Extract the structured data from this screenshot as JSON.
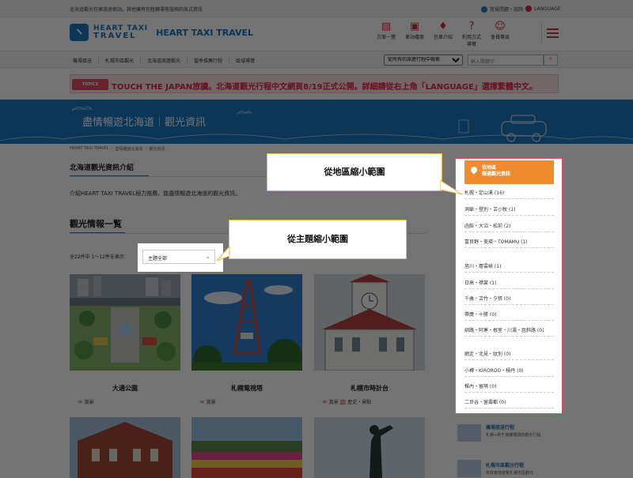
{
  "top_bar": {
    "left_text": "北海道觀光包車旅遊網站。其他擁有包租轉運等服務的各式資訊",
    "lang_links": [
      "常見問題・諮詢",
      "LANGUAGE"
    ]
  },
  "header": {
    "logo_line1": "HEART TAXI",
    "logo_line2": "TRAVEL",
    "brand": "HEART TAXI TRAVEL",
    "icons": [
      {
        "name": "plan-list-icon",
        "label": "方案一覽"
      },
      {
        "name": "area-icon",
        "label": "車站檔案"
      },
      {
        "name": "tour-icon",
        "label": "包車介紹"
      },
      {
        "name": "guide-icon",
        "label": "利用方式導覽"
      },
      {
        "name": "member-icon",
        "label": "會員專頁"
      }
    ]
  },
  "nav": {
    "items": [
      "機場接送",
      "札幌市區觀光",
      "北海道周遊觀光",
      "當季推薦行程",
      "區域導覽"
    ],
    "select_label": "從所有的旅遊行程中檢索",
    "search_placeholder": "輸入關鍵字"
  },
  "topics": {
    "tag": "TOPICS",
    "text": "TOUCH THE JAPAN旅讀。北海道觀光行程中文網頁8/19正式公開。詳細請從右上角「LANGUAGE」選擇繁體中文。"
  },
  "banner": {
    "title": "盡情暢遊北海道｜觀光資訊"
  },
  "breadcrumb": [
    "HEART TAXI TRAVEL",
    "盡情暢遊北海道",
    "觀光資訊"
  ],
  "intro": {
    "title": "北海道觀光資訊介紹",
    "text": "介紹HEART TAXI TRAVEL極力推薦、能盡情暢遊北海道的觀光資訊。"
  },
  "list": {
    "title": "觀光情報一覧",
    "count_text": "全22件中 1〜12件を表示",
    "filter_value": "主題全部"
  },
  "cards": [
    {
      "title": "大通公園",
      "tags": [
        "賞景"
      ]
    },
    {
      "title": "札幌電視塔",
      "tags": [
        "賞景"
      ]
    },
    {
      "title": "札幌市時計台",
      "tags": [
        "賞景",
        "歷史・景點"
      ]
    }
  ],
  "sidebar": {
    "heading_line1": "依地區",
    "heading_line2": "篩選觀光資訊",
    "regions": [
      "札幌・定山溪 (16)",
      "洞爺・登別・苫小牧 (1)",
      "函館・大沼・松前 (2)",
      "富良野・美瑛・TOMAMU (1)",
      "旭川・層雲峽 (1)",
      "日高・襟裳 (1)",
      "千歲・苫竹・夕張 (0)",
      "帶廣・十勝 (0)",
      "釧路・阿寒・根室・川湯・屈斜路 (0)",
      "網走・北見・紋別 (0)",
      "小樽・KIROROO・積丹 (0)",
      "稚內・留萌 (0)",
      "二世谷・留壽都 (0)"
    ]
  },
  "related": [
    {
      "title": "機場接送行程",
      "desc": "札幌⇔新千歲機場間的觀光行程"
    },
    {
      "title": "札幌市區觀光行程",
      "desc": "有效率地遊覧札幌市區觀光"
    }
  ],
  "callouts": {
    "region": "從地區縮小範圍",
    "theme": "從主題縮小範圍"
  },
  "colors": {
    "brand_blue": "#1a78c2",
    "accent_red": "#d63040",
    "highlight_orange": "#ef8b2c"
  }
}
